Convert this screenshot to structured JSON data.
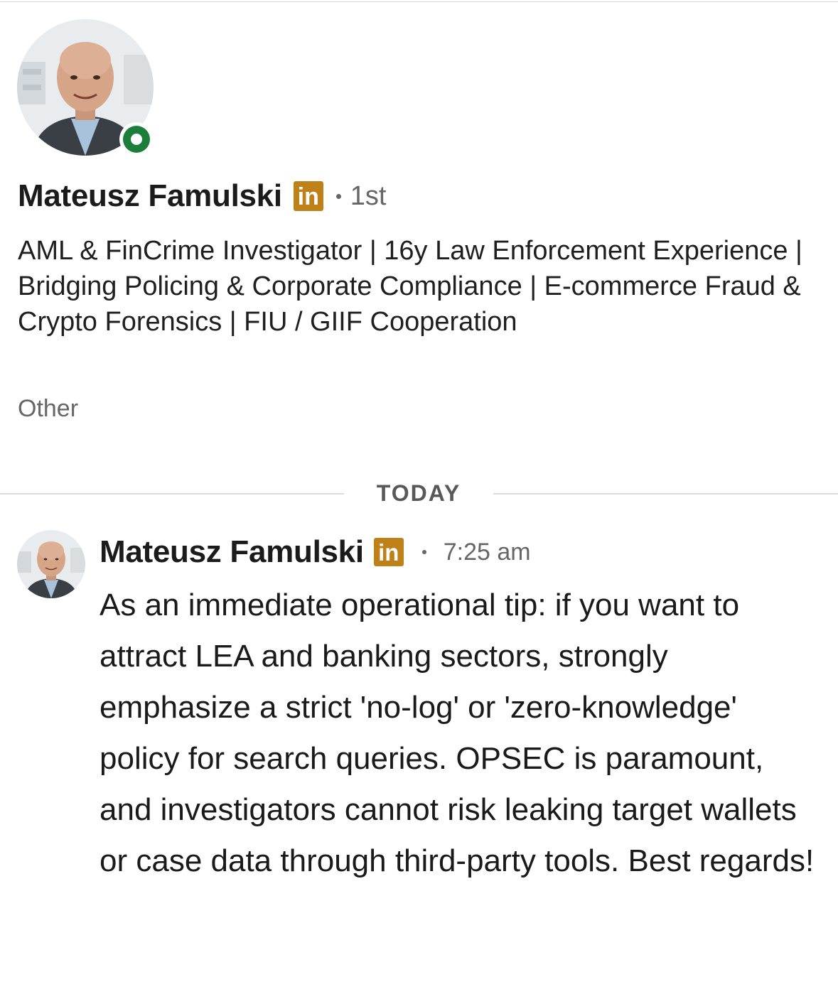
{
  "profile": {
    "name": "Mateusz Famulski",
    "badge": "in",
    "degree": "1st",
    "headline": "AML & FinCrime Investigator | 16y Law Enforcement Experience | Bridging Policing & Corporate Compliance | E-commerce Fraud & Crypto Forensics | FIU / GIIF Cooperation",
    "location": "Other",
    "online": true,
    "icons": {
      "avatar": "profile-photo",
      "presence": "online-status-icon",
      "badge": "linkedin-premium-icon"
    }
  },
  "divider": {
    "label": "TODAY"
  },
  "messages": [
    {
      "sender": "Mateusz Famulski",
      "badge": "in",
      "time": "7:25 am",
      "body": "As an immediate operational tip: if you want to attract LEA and banking sectors, strongly emphasize a strict 'no-log' or 'zero-knowledge' policy for search queries. OPSEC is paramount, and investigators cannot risk leaking target wallets or case data through third-party tools. Best regards!"
    }
  ],
  "colors": {
    "online_green": "#1b7f3b",
    "badge_gold": "#c08018",
    "secondary_text": "#666666",
    "divider": "#dcdcdc"
  }
}
